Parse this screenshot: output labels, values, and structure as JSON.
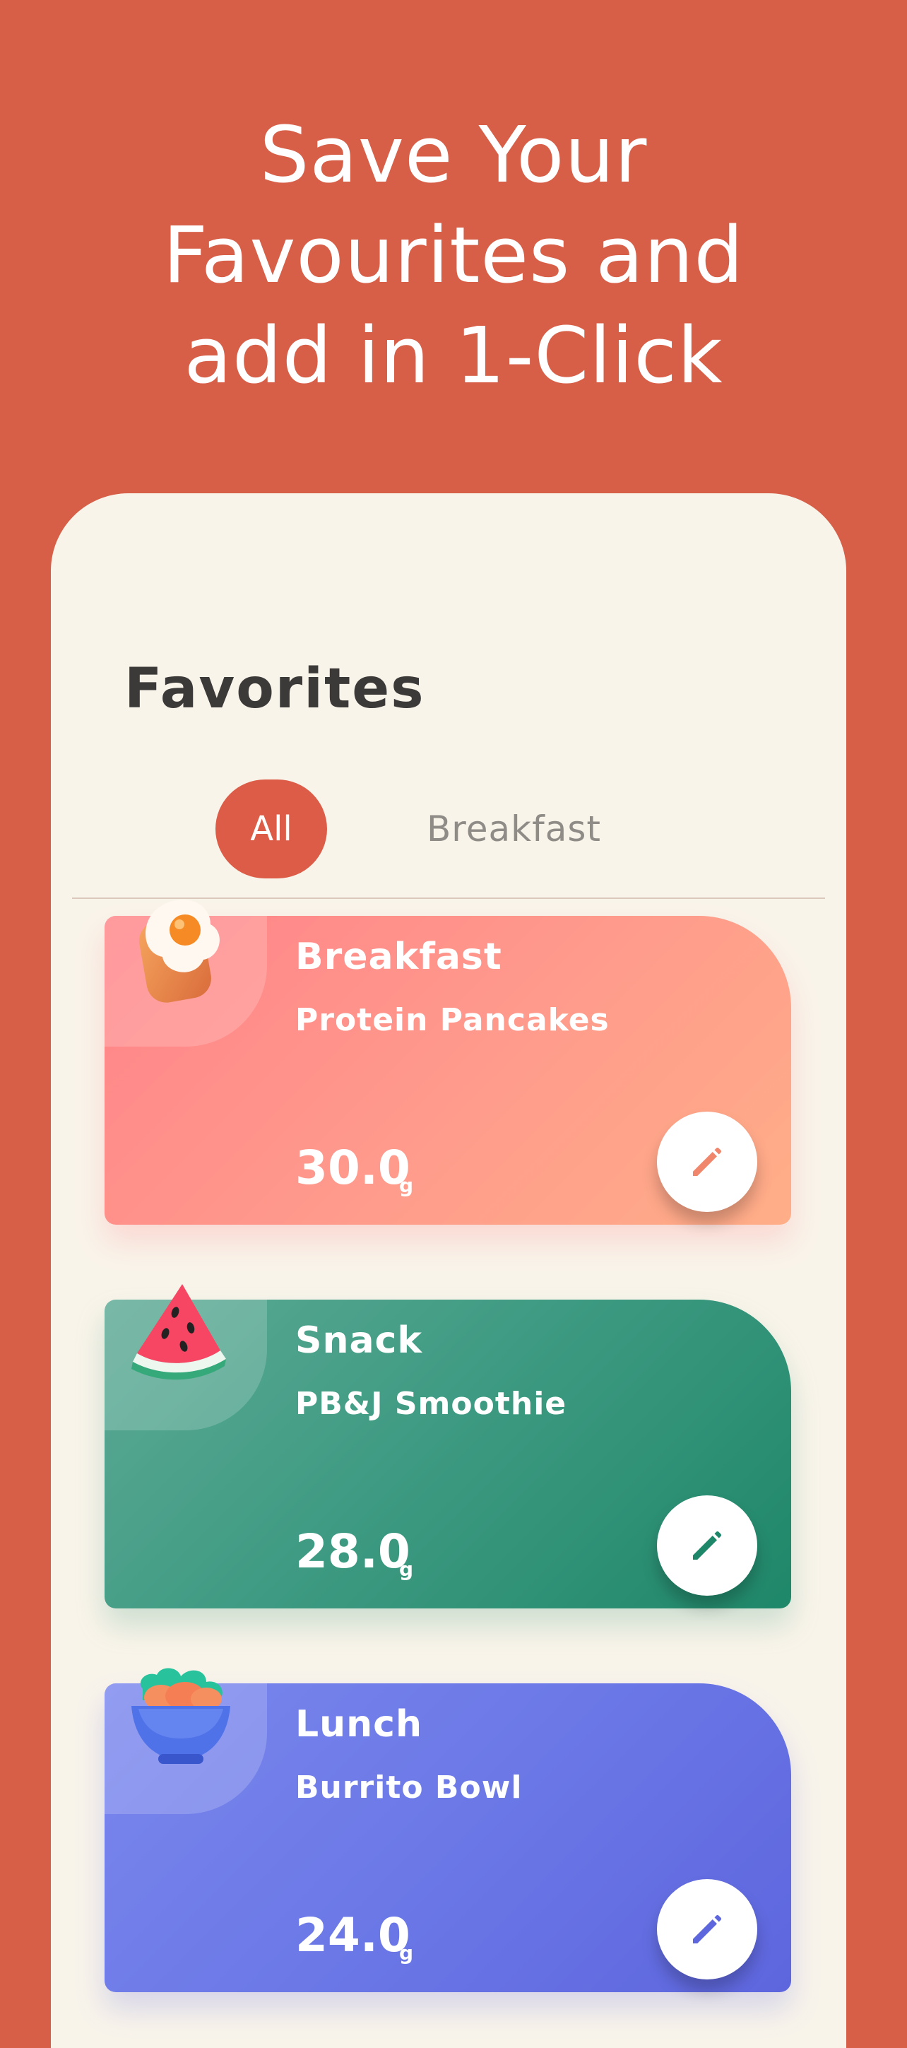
{
  "headline": {
    "line1": "Save Your",
    "line2": "Favourites and",
    "line3": "add in 1-Click"
  },
  "favorites": {
    "title": "Favorites",
    "tabs": [
      {
        "label": "All",
        "selected": true
      },
      {
        "label": "Breakfast",
        "selected": false
      }
    ],
    "items": [
      {
        "meal_type": "Breakfast",
        "meal_name": "Protein Pancakes",
        "amount": "30.0",
        "unit": "g",
        "icon": "fried-egg-toast-icon",
        "accent": "#ff9a8c"
      },
      {
        "meal_type": "Snack",
        "meal_name": "PB&J Smoothie",
        "amount": "28.0",
        "unit": "g",
        "icon": "watermelon-slice-icon",
        "accent": "#3f9b83"
      },
      {
        "meal_type": "Lunch",
        "meal_name": "Burrito Bowl",
        "amount": "24.0",
        "unit": "g",
        "icon": "food-bowl-icon",
        "accent": "#6b78e6"
      }
    ]
  },
  "colors": {
    "background": "#d75f48",
    "panel": "#f9f4ea",
    "selected_tab": "#dc5c47",
    "title_text": "#3c3a39",
    "muted_text": "#8f8b86"
  }
}
